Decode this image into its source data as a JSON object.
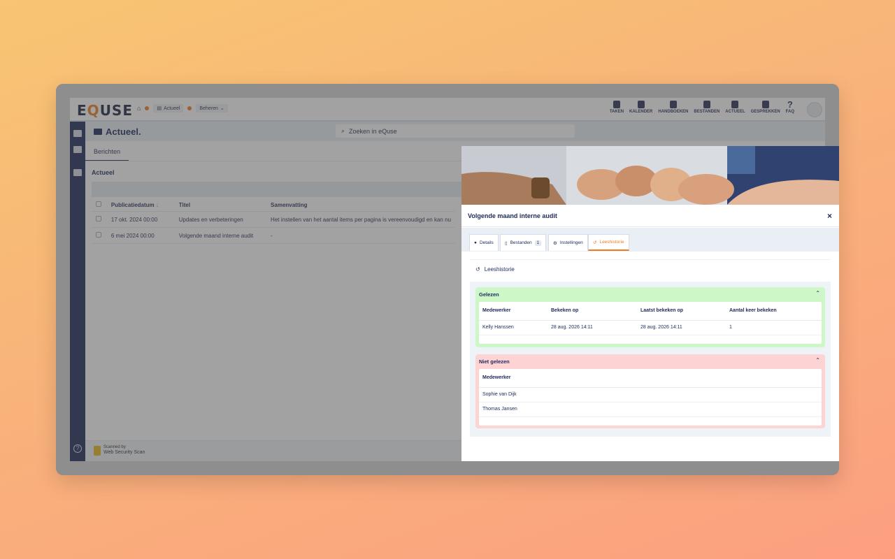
{
  "app": {
    "logo": {
      "pre": "E",
      "accent": "Q",
      "post": "USE"
    },
    "breadcrumb": [
      "Actueel",
      "Beheren"
    ],
    "topnav": [
      "TAKEN",
      "KALENDER",
      "HANDBOEKEN",
      "BESTANDEN",
      "ACTUEEL",
      "GESPREKKEN",
      "FAQ"
    ],
    "page_title": "Actueel.",
    "search_placeholder": "Zoeken in eQuse",
    "tab": "Berichten",
    "section": "Actueel",
    "footer_badge": [
      "Scanned by",
      "Web Security Scan"
    ]
  },
  "list": {
    "headers": [
      "Publicatiedatum",
      "Titel",
      "Samenvatting"
    ],
    "sort_arrow": "↓",
    "rows": [
      {
        "date": "17 okt. 2024 00:00",
        "title": "Updates en verbeteringen",
        "summary": "Het instellen van het aantal items per pagina is vereenvoudigd en kan nu"
      },
      {
        "date": "6 mei 2024 00:00",
        "title": "Volgende maand interne audit",
        "summary": "-"
      }
    ]
  },
  "modal": {
    "title": "Volgende maand interne audit",
    "close": "×",
    "tabs": [
      {
        "label": "Details"
      },
      {
        "label": "Bestanden",
        "count": "1"
      },
      {
        "label": "Instellingen"
      },
      {
        "label": "Leeshistorie"
      }
    ],
    "section_heading": "Leeshistorie",
    "read": {
      "title": "Gelezen",
      "headers": [
        "Medewerker",
        "Bekeken op",
        "Laatst bekeken op",
        "Aantal keer bekeken"
      ],
      "rows": [
        [
          "Kelly Hanssen",
          "28 aug. 2026 14:11",
          "28 aug. 2026 14:11",
          "1"
        ]
      ]
    },
    "unread": {
      "title": "Niet gelezen",
      "headers": [
        "Medewerker"
      ],
      "rows": [
        "Sophie van Dijk",
        "Thomas Jansen"
      ]
    }
  },
  "colors": {
    "accent": "#ef7d22",
    "navy": "#1e2a5a",
    "read_bg": "#cdf7c6",
    "unread_bg": "#fdd3d3"
  }
}
